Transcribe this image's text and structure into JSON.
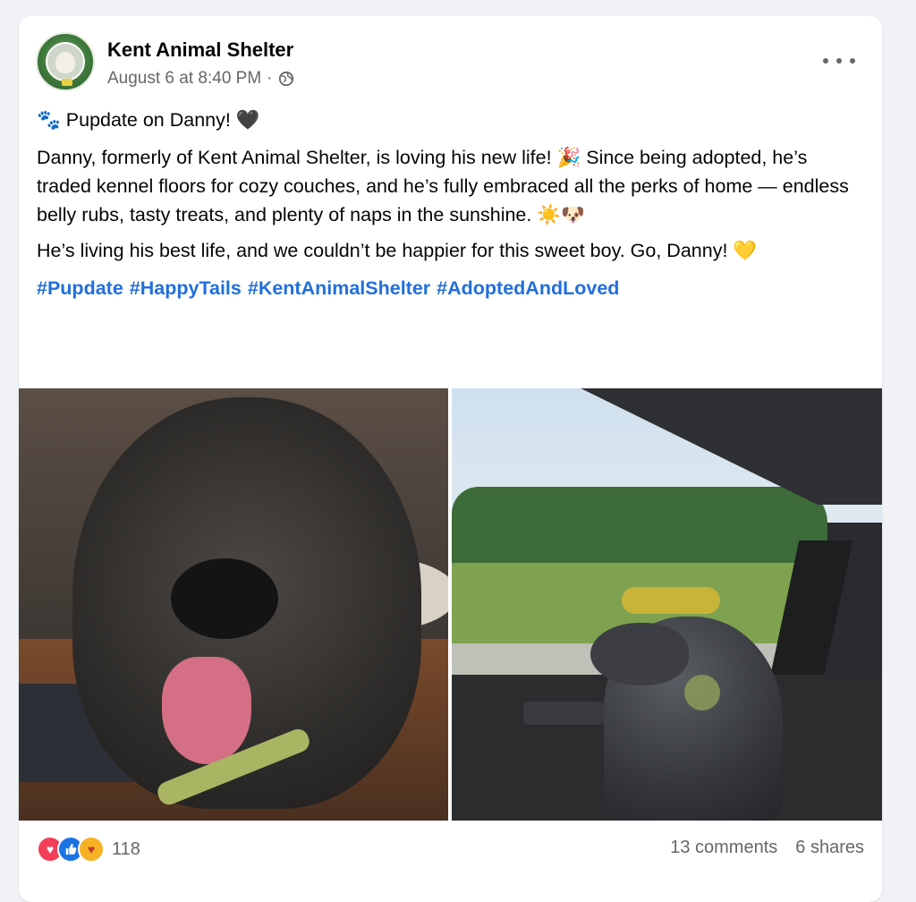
{
  "post": {
    "page_name": "Kent Animal Shelter",
    "timestamp": "August 6 at 8:40 PM",
    "separator": "·",
    "visibility_icon": "globe-icon",
    "title_emoji_start": "🐾",
    "title": "Pupdate on Danny!",
    "title_emoji_end": "🖤",
    "paragraph1": "Danny, formerly of Kent Animal Shelter, is loving his new life! 🎉 Since being adopted, he’s traded kennel floors for cozy couches, and he’s fully embraced all the perks of home — endless belly rubs, tasty treats, and plenty of naps in the sunshine. ☀️🐶",
    "paragraph2": "He’s living his best life, and we couldn’t be happier for this sweet boy. Go, Danny! 💛",
    "hashtags": [
      "#Pupdate",
      "#HappyTails",
      "#KentAnimalShelter",
      "#AdoptedAndLoved"
    ],
    "photos": [
      "dog-closeup-photo",
      "dog-in-car-photo"
    ]
  },
  "engagement": {
    "reaction_icons": [
      "love-reaction-icon",
      "like-reaction-icon",
      "care-reaction-icon"
    ],
    "reaction_count": "118",
    "comments": "13 comments",
    "shares": "6 shares"
  },
  "colors": {
    "page_bg": "#f0f2f5",
    "card_bg": "#ffffff",
    "text": "#050505",
    "secondary_text": "#65676b",
    "hashtag": "#216fdb"
  }
}
